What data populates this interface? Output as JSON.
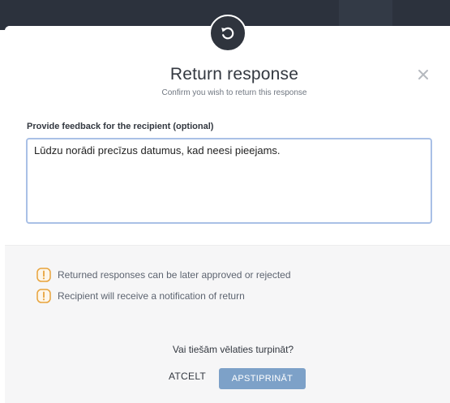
{
  "dialog": {
    "title": "Return response",
    "subtitle": "Confirm you wish to return this response",
    "icon": "undo-icon",
    "close_icon": "close-icon"
  },
  "feedback": {
    "label": "Provide feedback for the recipient (optional)",
    "value": "Lūdzu norādi precīzus datumus, kad neesi pieejams."
  },
  "notes": [
    {
      "icon": "warning-icon",
      "text": "Returned responses can be later approved or rejected"
    },
    {
      "icon": "warning-icon",
      "text": "Recipient will receive a notification of return"
    }
  ],
  "confirm": {
    "question": "Vai tiešām vēlaties turpināt?",
    "cancel_label": "ATCELT",
    "confirm_label": "APSTIPRINĀT"
  },
  "colors": {
    "topbar": "#2c323d",
    "accent": "#7da1c8",
    "warning": "#e8a33b",
    "input_border": "#a9c0e6"
  }
}
